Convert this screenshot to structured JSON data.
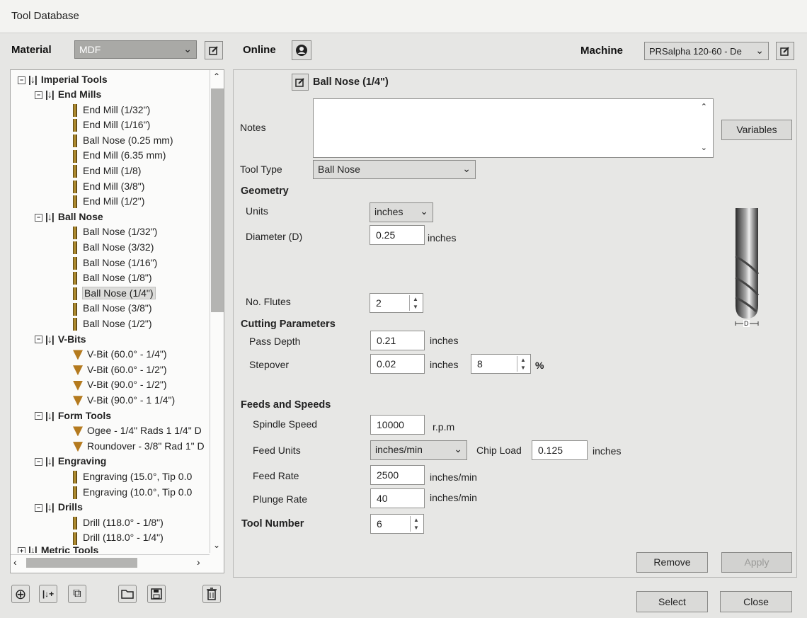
{
  "window": {
    "title": "Tool Database"
  },
  "topbar": {
    "material_label": "Material",
    "material_value": "MDF",
    "online_label": "Online",
    "machine_label": "Machine",
    "machine_value": "PRSalpha 120-60 - De"
  },
  "tree": {
    "root": "Imperial Tools",
    "groups": [
      {
        "label": "End Mills",
        "items": [
          "End Mill (1/32\")",
          "End Mill (1/16\")",
          "Ball Nose (0.25 mm)",
          "End Mill (6.35 mm)",
          "End Mill (1/8)",
          "End Mill (3/8\")",
          "End Mill (1/2\")"
        ]
      },
      {
        "label": "Ball Nose",
        "items": [
          "Ball Nose (1/32\")",
          "Ball Nose (3/32)",
          "Ball Nose (1/16\")",
          "Ball Nose (1/8\")",
          "Ball Nose (1/4\")",
          "Ball Nose (3/8\")",
          "Ball Nose (1/2\")"
        ]
      },
      {
        "label": "V-Bits",
        "items": [
          "V-Bit (60.0° - 1/4\")",
          "V-Bit (60.0° - 1/2\")",
          "V-Bit (90.0° - 1/2\")",
          "V-Bit (90.0° - 1 1/4\")"
        ]
      },
      {
        "label": "Form Tools",
        "items": [
          "Ogee - 1/4\" Rads 1 1/4\" D",
          "Roundover - 3/8\" Rad 1\" D"
        ]
      },
      {
        "label": "Engraving",
        "items": [
          "Engraving (15.0°, Tip 0.0",
          "Engraving (10.0°, Tip 0.0"
        ]
      },
      {
        "label": "Drills",
        "items": [
          "Drill (118.0° - 1/8\")",
          "Drill (118.0° - 1/4\")"
        ]
      }
    ],
    "next_root_partial": "Metric Tools"
  },
  "editor": {
    "tool_name": "Ball Nose (1/4\")",
    "notes_label": "Notes",
    "notes_value": "",
    "variables_button": "Variables",
    "tool_type_label": "Tool Type",
    "tool_type_value": "Ball Nose",
    "geometry": {
      "title": "Geometry",
      "units_label": "Units",
      "units_value": "inches",
      "diameter_label": "Diameter (D)",
      "diameter_value": "0.25",
      "diameter_unit": "inches",
      "flutes_label": "No. Flutes",
      "flutes_value": "2",
      "diagram_label": "D"
    },
    "cutting": {
      "title": "Cutting Parameters",
      "pass_depth_label": "Pass Depth",
      "pass_depth_value": "0.21",
      "pass_depth_unit": "inches",
      "stepover_label": "Stepover",
      "stepover_value": "0.02",
      "stepover_unit": "inches",
      "stepover_percent": "8",
      "percent_sign": "%"
    },
    "feeds": {
      "title": "Feeds and Speeds",
      "spindle_label": "Spindle Speed",
      "spindle_value": "10000",
      "spindle_unit": "r.p.m",
      "feed_units_label": "Feed Units",
      "feed_units_value": "inches/min",
      "chip_load_label": "Chip Load",
      "chip_load_value": "0.125",
      "chip_load_unit": "inches",
      "feed_rate_label": "Feed Rate",
      "feed_rate_value": "2500",
      "feed_rate_unit": "inches/min",
      "plunge_label": "Plunge Rate",
      "plunge_value": "40",
      "plunge_unit": "inches/min"
    },
    "tool_number_label": "Tool Number",
    "tool_number_value": "6"
  },
  "buttons": {
    "remove": "Remove",
    "apply": "Apply",
    "select": "Select",
    "close": "Close"
  }
}
